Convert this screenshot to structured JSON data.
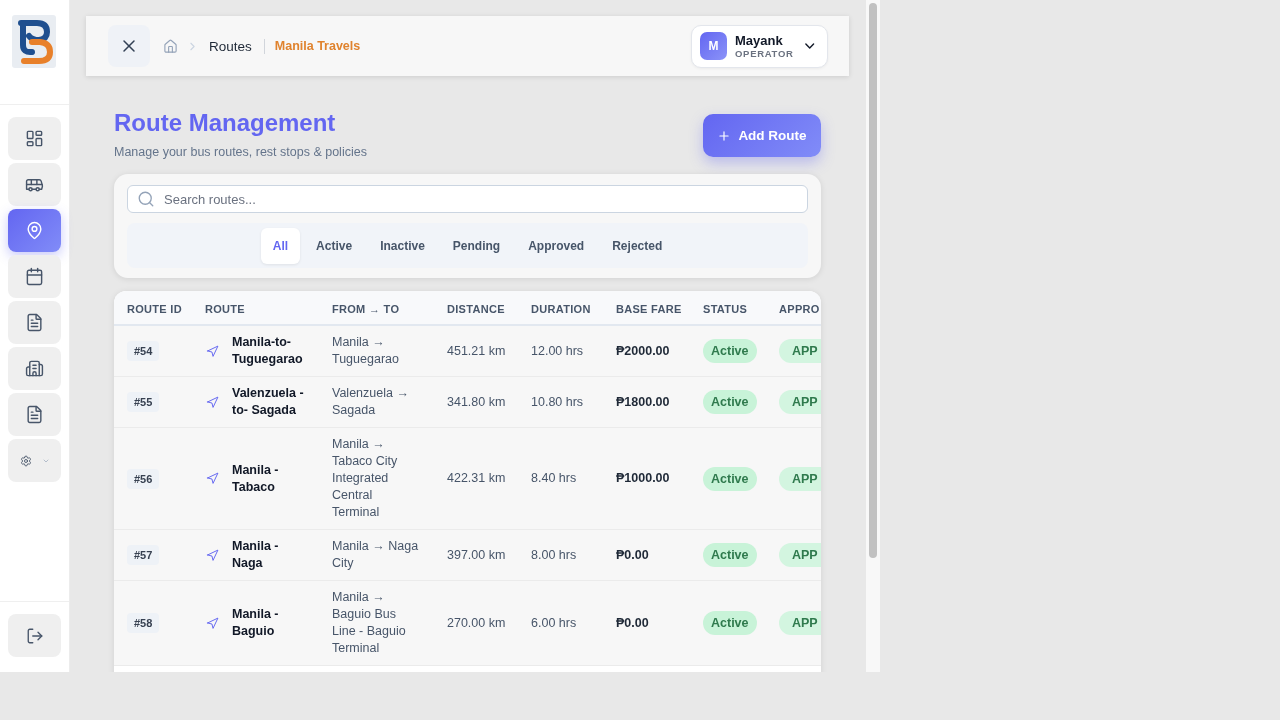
{
  "sidebar": {
    "items": [
      {
        "kind": "link",
        "selected": false
      },
      {
        "kind": "link",
        "selected": false
      },
      {
        "kind": "link",
        "selected": true
      },
      {
        "kind": "link",
        "selected": false
      },
      {
        "kind": "link",
        "selected": false
      },
      {
        "kind": "link",
        "selected": false
      },
      {
        "kind": "link",
        "selected": false
      },
      {
        "kind": "group",
        "selected": false,
        "expanded": false
      }
    ]
  },
  "header": {
    "breadcrumb": {
      "current": "Routes",
      "company": "Manila Travels"
    },
    "user": {
      "initial": "M",
      "name": "Mayank",
      "role": "OPERATOR"
    }
  },
  "page": {
    "title": "Route Management",
    "subtitle": "Manage your bus routes, rest stops & policies",
    "primary_action": "Add Route"
  },
  "filters": {
    "search": {
      "placeholder": "Search routes..."
    },
    "tabs": [
      {
        "label": "All",
        "selected": true
      },
      {
        "label": "Active",
        "selected": false
      },
      {
        "label": "Inactive",
        "selected": false
      },
      {
        "label": "Pending",
        "selected": false
      },
      {
        "label": "Approved",
        "selected": false
      },
      {
        "label": "Rejected",
        "selected": false
      }
    ]
  },
  "table": {
    "columns": [
      "ROUTE ID",
      "ROUTE",
      "FROM → TO",
      "DISTANCE",
      "DURATION",
      "BASE FARE",
      "STATUS",
      "APPRO"
    ],
    "rows": [
      {
        "id": "#54",
        "route": "Manila-to-Tuguegarao",
        "from_to": "Manila → Tuguegarao",
        "distance": "451.21 km",
        "duration": "12.00 hrs",
        "base_fare": "₱2000.00",
        "status": "Active",
        "column_8": "APP"
      },
      {
        "id": "#55",
        "route": "Valenzuela - to- Sagada",
        "from_to": "Valenzuela → Sagada",
        "distance": "341.80 km",
        "duration": "10.80 hrs",
        "base_fare": "₱1800.00",
        "status": "Active",
        "column_8": "APP"
      },
      {
        "id": "#56",
        "route": "Manila - Tabaco",
        "from_to": "Manila → Tabaco City Integrated Central Terminal",
        "distance": "422.31 km",
        "duration": "8.40 hrs",
        "base_fare": "₱1000.00",
        "status": "Active",
        "column_8": "APP"
      },
      {
        "id": "#57",
        "route": "Manila - Naga",
        "from_to": "Manila → Naga City",
        "distance": "397.00 km",
        "duration": "8.00 hrs",
        "base_fare": "₱0.00",
        "status": "Active",
        "column_8": "APP"
      },
      {
        "id": "#58",
        "route": "Manila - Baguio",
        "from_to": "Manila → Baguio Bus Line - Baguio Terminal",
        "distance": "270.00 km",
        "duration": "6.00 hrs",
        "base_fare": "₱0.00",
        "status": "Active",
        "column_8": "APP"
      }
    ]
  }
}
